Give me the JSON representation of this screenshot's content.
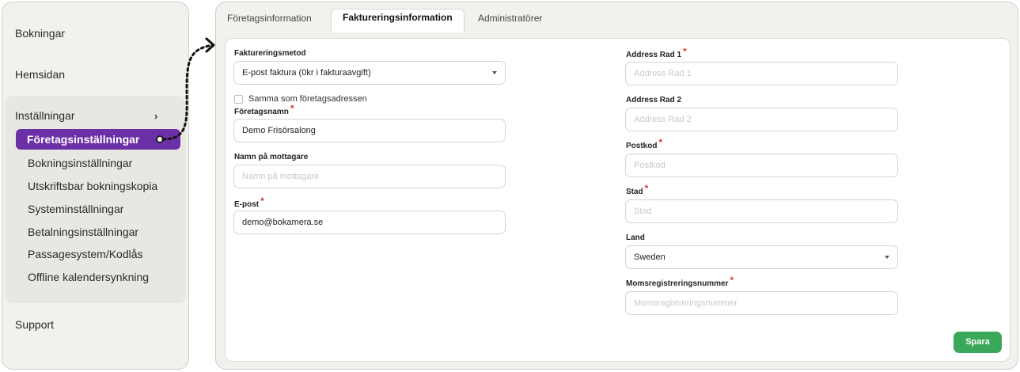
{
  "sidebar": {
    "bookings": "Bokningar",
    "homepage": "Hemsidan",
    "settings": "Inställningar",
    "chevron": "›",
    "active_item": "Företagsinställningar",
    "sub_items": [
      "Bokningsinställningar",
      "Utskriftsbar bokningskopia",
      "Systeminställningar",
      "Betalningsinställningar",
      "Passagesystem/Kodlås",
      "Offline kalendersynkning"
    ],
    "support": "Support"
  },
  "tabs": [
    "Företagsinformation",
    "Faktureringsinformation",
    "Administratörer"
  ],
  "form": {
    "billing_method": {
      "label": "Faktureringsmetod",
      "value": "E-post faktura (0kr i fakturaavgift)"
    },
    "same_address": {
      "label": "Samma som företagsadressen",
      "checked": false
    },
    "company_name": {
      "label": "Företagsnamn",
      "required": "*",
      "value": "Demo Frisörsalong"
    },
    "recipient": {
      "label": "Namn på mottagare",
      "placeholder": "Namn på mottagare"
    },
    "email": {
      "label": "E-post",
      "required": "*",
      "value": "demo@bokamera.se"
    },
    "address1": {
      "label": "Address Rad 1",
      "required": "*",
      "placeholder": "Address Rad 1"
    },
    "address2": {
      "label": "Address Rad 2",
      "placeholder": "Address Rad 2"
    },
    "postcode": {
      "label": "Postkod",
      "required": "*",
      "placeholder": "Postkod"
    },
    "city": {
      "label": "Stad",
      "required": "*",
      "placeholder": "Stad"
    },
    "country": {
      "label": "Land",
      "value": "Sweden"
    },
    "vat": {
      "label": "Momsregistreringsnummer",
      "required": "*",
      "placeholder": "Momsregistreringsnummer"
    },
    "save_label": "Spara"
  },
  "colors": {
    "accent": "#6b2fa7",
    "save": "#3aa75b",
    "required": "#d23c3c"
  }
}
